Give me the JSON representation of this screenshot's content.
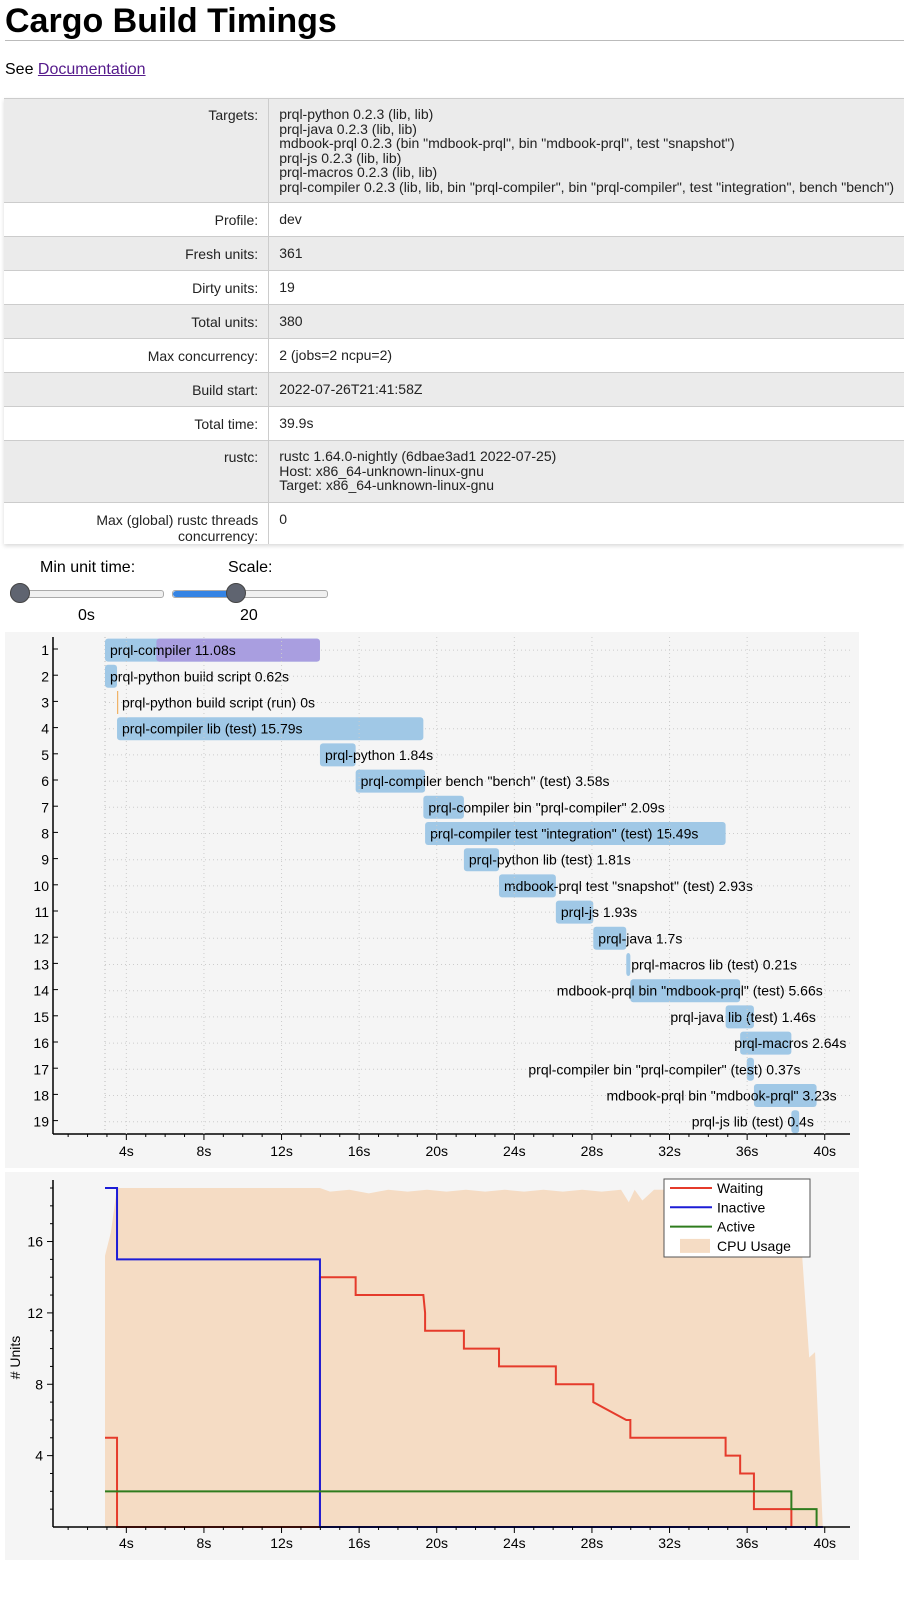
{
  "title": "Cargo Build Timings",
  "see_prefix": "See",
  "documentation_link": "Documentation",
  "summary": [
    {
      "key": "Targets:",
      "lines": [
        "prql-python 0.2.3 (lib, lib)",
        "prql-java 0.2.3 (lib, lib)",
        "mdbook-prql 0.2.3 (bin \"mdbook-prql\", bin \"mdbook-prql\", test \"snapshot\")",
        "prql-js 0.2.3 (lib, lib)",
        "prql-macros 0.2.3 (lib, lib)",
        "prql-compiler 0.2.3 (lib, lib, bin \"prql-compiler\", bin \"prql-compiler\", test \"integration\", bench \"bench\")"
      ]
    },
    {
      "key": "Profile:",
      "lines": [
        "dev"
      ]
    },
    {
      "key": "Fresh units:",
      "lines": [
        "361"
      ]
    },
    {
      "key": "Dirty units:",
      "lines": [
        "19"
      ]
    },
    {
      "key": "Total units:",
      "lines": [
        "380"
      ]
    },
    {
      "key": "Max concurrency:",
      "lines": [
        "2 (jobs=2 ncpu=2)"
      ]
    },
    {
      "key": "Build start:",
      "lines": [
        "2022-07-26T21:41:58Z"
      ]
    },
    {
      "key": "Total time:",
      "lines": [
        "39.9s"
      ]
    },
    {
      "key": "rustc:",
      "lines": [
        "rustc 1.64.0-nightly (6dbae3ad1 2022-07-25)",
        "Host: x86_64-unknown-linux-gnu",
        "Target: x86_64-unknown-linux-gnu"
      ]
    },
    {
      "key": "Max (global) rustc threads concurrency:",
      "lines": [
        "0"
      ]
    }
  ],
  "controls": {
    "min_unit_time_label": "Min unit time:",
    "min_unit_time_value": "0s",
    "min_unit_time_fraction": 0.0,
    "scale_label": "Scale:",
    "scale_value": "20",
    "scale_fraction": 0.4
  },
  "colors": {
    "unit_bar": "#a0c8e6",
    "codegen_bar": "#a99ee0",
    "run_custom_build": "#f0b165",
    "waiting": "#e53b2b",
    "inactive": "#1c1cd6",
    "active": "#2f7c1e",
    "cpu_usage": "#f5dcc4",
    "panel_bg": "#f5f5f5"
  },
  "chart_data": [
    {
      "type": "bar",
      "xlim": [
        0,
        40
      ],
      "x_ticks": [
        "4s",
        "8s",
        "12s",
        "16s",
        "20s",
        "24s",
        "28s",
        "32s",
        "36s",
        "40s"
      ],
      "units": [
        {
          "n": "1",
          "label": "prql-compiler 11.08s",
          "start": 2.9,
          "duration": 11.08,
          "codegen_start": 5.55
        },
        {
          "n": "2",
          "label": "prql-python build script 0.62s",
          "start": 2.9,
          "duration": 0.62
        },
        {
          "n": "3",
          "label": "prql-python build script (run) 0s",
          "start": 3.52,
          "duration": 0.0,
          "kind": "run-custom-build"
        },
        {
          "n": "4",
          "label": "prql-compiler lib (test) 15.79s",
          "start": 3.52,
          "duration": 15.79
        },
        {
          "n": "5",
          "label": "prql-python 1.84s",
          "start": 13.98,
          "duration": 1.84
        },
        {
          "n": "6",
          "label": "prql-compiler bench \"bench\" (test) 3.58s",
          "start": 15.82,
          "duration": 3.58
        },
        {
          "n": "7",
          "label": "prql-compiler bin \"prql-compiler\" 2.09s",
          "start": 19.31,
          "duration": 2.09
        },
        {
          "n": "8",
          "label": "prql-compiler test \"integration\" (test) 15.49s",
          "start": 19.4,
          "duration": 15.49
        },
        {
          "n": "9",
          "label": "prql-python lib (test) 1.81s",
          "start": 21.4,
          "duration": 1.81
        },
        {
          "n": "10",
          "label": "mdbook-prql test \"snapshot\" (test) 2.93s",
          "start": 23.21,
          "duration": 2.93
        },
        {
          "n": "11",
          "label": "prql-js 1.93s",
          "start": 26.14,
          "duration": 1.93
        },
        {
          "n": "12",
          "label": "prql-java 1.7s",
          "start": 28.07,
          "duration": 1.7
        },
        {
          "n": "13",
          "label": "prql-macros lib (test) 0.21s",
          "start": 29.77,
          "duration": 0.21
        },
        {
          "n": "14",
          "label": "mdbook-prql bin \"mdbook-prql\" (test) 5.66s",
          "start": 29.98,
          "duration": 5.66
        },
        {
          "n": "15",
          "label": "prql-java lib (test) 1.46s",
          "start": 34.89,
          "duration": 1.46
        },
        {
          "n": "16",
          "label": "prql-macros 2.64s",
          "start": 35.64,
          "duration": 2.64
        },
        {
          "n": "17",
          "label": "prql-compiler bin \"prql-compiler\" (test) 0.37s",
          "start": 35.98,
          "duration": 0.37
        },
        {
          "n": "18",
          "label": "mdbook-prql bin \"mdbook-prql\" 3.23s",
          "start": 36.35,
          "duration": 3.23
        },
        {
          "n": "19",
          "label": "prql-js lib (test) 0.4s",
          "start": 38.28,
          "duration": 0.4
        }
      ]
    },
    {
      "type": "line",
      "xlim": [
        0,
        40
      ],
      "ylim": [
        0,
        19
      ],
      "ylabel": "# Units",
      "x_ticks": [
        "4s",
        "8s",
        "12s",
        "16s",
        "20s",
        "24s",
        "28s",
        "32s",
        "36s",
        "40s"
      ],
      "y_ticks": [
        4,
        8,
        12,
        16
      ],
      "legend": [
        "Waiting",
        "Inactive",
        "Active",
        "CPU Usage"
      ],
      "legend_position": "top-right",
      "series": [
        {
          "name": "Waiting",
          "x": [
            2.9,
            3.52,
            3.52,
            13.98,
            13.98,
            15.82,
            15.82,
            19.31,
            19.4,
            19.4,
            21.4,
            21.4,
            23.21,
            23.21,
            26.14,
            26.14,
            28.07,
            28.07,
            29.77,
            29.98,
            29.98,
            34.89,
            34.89,
            35.64,
            35.64,
            36.35,
            36.35,
            38.28,
            38.28,
            39.9
          ],
          "y": [
            5,
            5,
            0,
            0,
            14,
            14,
            13,
            13,
            12,
            11,
            11,
            10,
            10,
            9,
            9,
            8,
            8,
            7,
            6,
            6,
            5,
            5,
            4,
            4,
            3,
            3,
            1,
            1,
            0,
            0
          ]
        },
        {
          "name": "Inactive",
          "x": [
            2.9,
            3.52,
            3.52,
            13.98,
            13.98,
            39.9
          ],
          "y": [
            19,
            19,
            15,
            15,
            0,
            0
          ]
        },
        {
          "name": "Active",
          "x": [
            2.9,
            38.28,
            38.28,
            39.58,
            39.58
          ],
          "y": [
            2,
            2,
            1,
            1,
            0
          ]
        },
        {
          "name": "CPU Usage",
          "x": [
            2.9,
            3.2,
            3.52,
            5,
            8,
            10,
            12,
            13.98,
            14.5,
            15.5,
            16.5,
            17.5,
            18.5,
            19.5,
            20.5,
            21.5,
            22.5,
            23.5,
            24.5,
            25.5,
            26.5,
            27.5,
            28.5,
            29.5,
            29.9,
            30.2,
            30.6,
            31.2,
            32,
            34,
            36,
            37,
            38,
            38.6,
            39.2,
            39.5,
            39.9
          ],
          "y": [
            15.2,
            16.5,
            19,
            19,
            19,
            19,
            19,
            19,
            18.8,
            18.9,
            18.7,
            18.9,
            18.8,
            18.9,
            18.8,
            18.9,
            18.8,
            18.9,
            18.8,
            18.9,
            18.8,
            18.9,
            18.8,
            18.9,
            18.2,
            18.9,
            18.3,
            18.9,
            18.9,
            18.9,
            18.9,
            18.9,
            18.9,
            18.9,
            9.5,
            9.8,
            0
          ]
        }
      ]
    }
  ]
}
